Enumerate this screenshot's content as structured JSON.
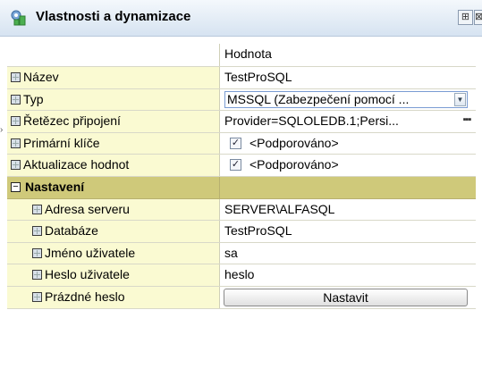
{
  "panel": {
    "title": "Vlastnosti a dynamizace",
    "pin_glyph": "⊞",
    "close_glyph": "⊠"
  },
  "grid": {
    "value_header": "Hodnota",
    "rows": [
      {
        "label": "Název",
        "value": "TestProSQL"
      },
      {
        "label": "Typ",
        "value": "MSSQL (Zabezpečení pomocí ..."
      },
      {
        "label": "Řetězec připojení",
        "value": "Provider=SQLOLEDB.1;Persi..."
      },
      {
        "label": "Primární klíče",
        "value": "<Podporováno>"
      },
      {
        "label": "Aktualizace hodnot",
        "value": "<Podporováno>"
      }
    ],
    "section": {
      "label": "Nastavení",
      "toggle": "−",
      "rows": [
        {
          "label": "Adresa serveru",
          "value": "SERVER\\ALFASQL"
        },
        {
          "label": "Databáze",
          "value": "TestProSQL"
        },
        {
          "label": "Jméno uživatele",
          "value": "sa"
        },
        {
          "label": "Heslo uživatele",
          "value": "heslo"
        },
        {
          "label": "Prázdné heslo",
          "button_label": "Nastavit"
        }
      ]
    }
  },
  "colors": {
    "name_column": "#fafad2",
    "section": "#cfc97a",
    "select_border": "#7a9cd3"
  },
  "icons": {
    "title": "properties-icon",
    "property": "property-icon",
    "dropdown": "chevron-down-icon",
    "ellipsis": "ellipsis-icon",
    "checkbox": "check-icon"
  }
}
